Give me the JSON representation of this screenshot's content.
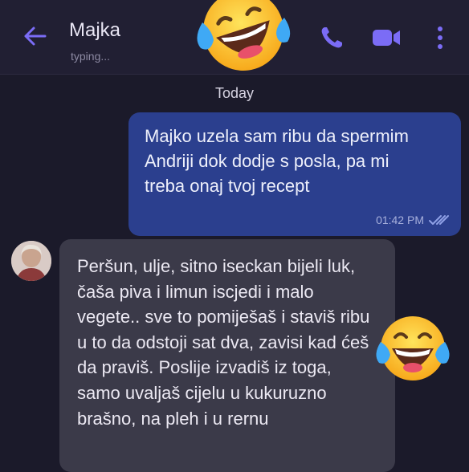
{
  "header": {
    "contact_name": "Majka",
    "status": "typing...",
    "icons": [
      "back-arrow-icon",
      "phone-icon",
      "video-icon",
      "more-vertical-icon"
    ]
  },
  "date_divider": "Today",
  "messages": [
    {
      "direction": "outgoing",
      "text": "Majko uzela sam ribu da spermim Andriji dok dodje s posla, pa mi treba onaj tvoj recept",
      "time": "01:42 PM",
      "status": "read"
    },
    {
      "direction": "incoming",
      "text": "Peršun, ulje, sitno iseckan bijeli luk, čaša piva i limun iscjedi i malo vegete.. sve to pomiješaš i staviš ribu u to da odstoji sat dva, zavisi kad ćeš da praviš. Poslije izvadiš iz toga, samo uvaljaš cijelu u kukuruzno brašno, na pleh i u rernu"
    }
  ],
  "colors": {
    "background": "#1b1a2a",
    "header": "#211f33",
    "accent": "#7b6cf6",
    "outgoing_bubble": "#2b3f8e",
    "incoming_bubble": "#3b3a49"
  },
  "stickers": [
    "laughing-tears-emoji",
    "laughing-tears-emoji"
  ]
}
